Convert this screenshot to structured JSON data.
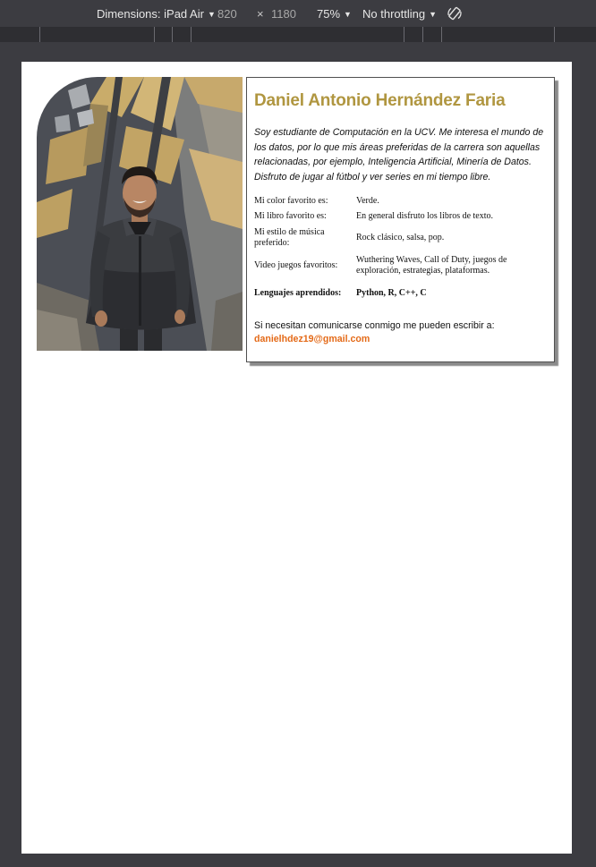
{
  "devtools": {
    "dimensions_label": "Dimensions: iPad Air",
    "width": "820",
    "times": "×",
    "height": "1180",
    "zoom": "75%",
    "throttling": "No throttling"
  },
  "profile": {
    "name": "Daniel Antonio Hernández Faria",
    "bio": "Soy estudiante de Computación en la UCV. Me interesa el mundo de los datos, por lo que mis áreas preferidas de la carrera son aquellas relacionadas, por ejemplo, Inteligencia Artificial, Minería de Datos. Disfruto de jugar al fútbol y ver series en mi tiempo libre.",
    "facts": [
      {
        "label": "Mi color favorito es:",
        "value": "Verde."
      },
      {
        "label": "Mi libro favorito es:",
        "value": "En general disfruto los libros de texto."
      },
      {
        "label": "Mi estilo de música preferido:",
        "value": "Rock clásico, salsa, pop."
      },
      {
        "label": "Video juegos favoritos:",
        "value": "Wuthering Waves, Call of Duty, juegos de exploración, estrategias, plataformas."
      },
      {
        "label": "Lenguajes aprendidos:",
        "value": "Python, R, C++, C"
      }
    ],
    "contact_text": "Si necesitan comunicarse conmigo me pueden escribir a:",
    "email": "danielhdez19@gmail.com"
  },
  "colors": {
    "name": "#b09640",
    "email": "#e46a18",
    "devtools_bg": "#3c3c41"
  }
}
